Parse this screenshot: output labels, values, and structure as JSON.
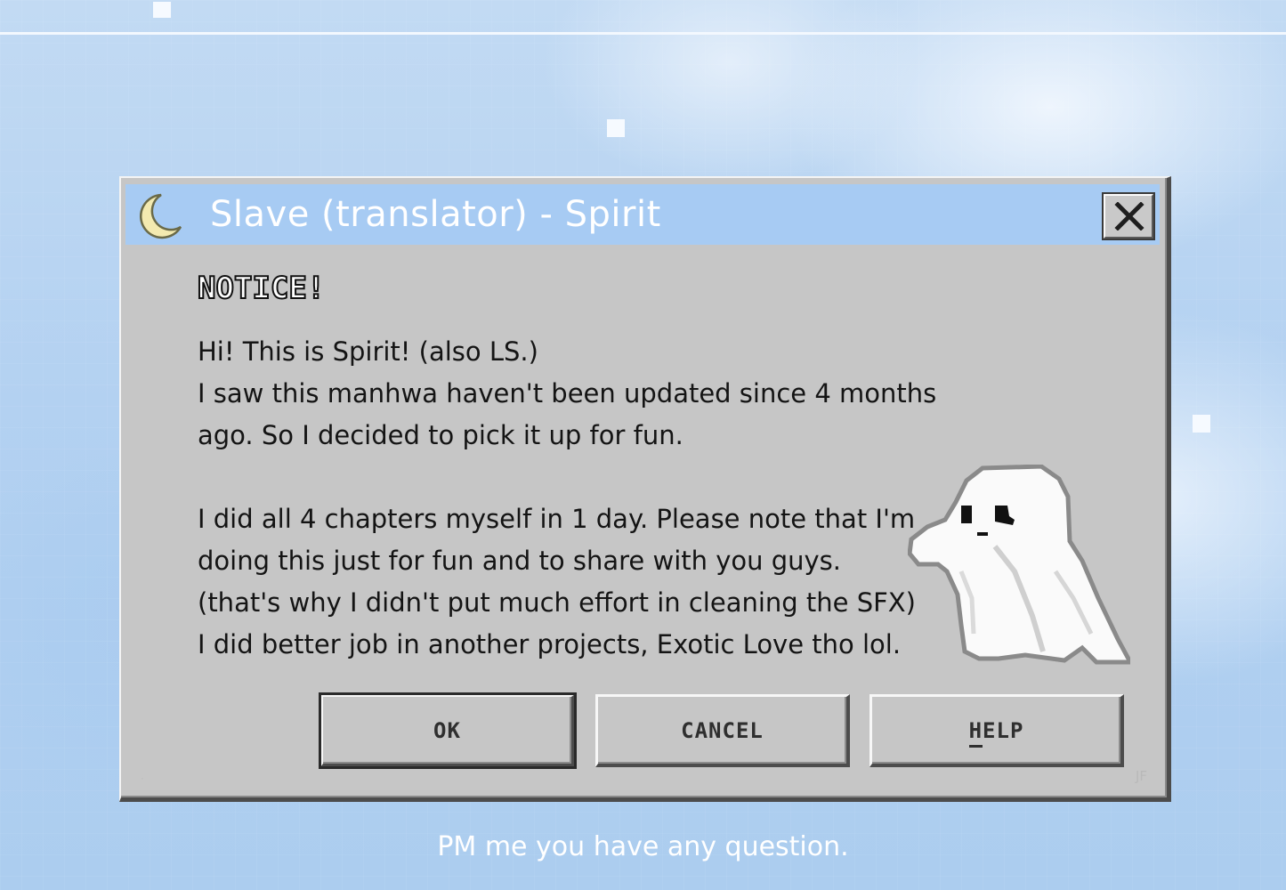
{
  "window": {
    "title": "Slave (translator) - Spirit",
    "close_symbol": "✕",
    "icon": "crescent-moon-icon"
  },
  "notice": {
    "heading": "NOTICE!",
    "lines": [
      "Hi! This is Spirit! (also LS.)",
      "I saw this manhwa haven't been updated since 4 months",
      "ago. So I decided to pick it up for fun.",
      "",
      "I did all 4 chapters myself in 1 day. Please note that I'm",
      "doing this just for fun and to share with you guys.",
      "(that's why I didn't put much effort in cleaning the SFX)",
      "I did better job in another projects, Exotic Love tho lol."
    ]
  },
  "buttons": {
    "ok": "OK",
    "cancel": "CANCEL",
    "help": "HELP"
  },
  "watermark": "JF",
  "footer": "PM me you have any question.",
  "colors": {
    "titlebar": "#a7cbf3",
    "dialog_face": "#c6c6c6",
    "background_sky": "#b3d1f1"
  }
}
